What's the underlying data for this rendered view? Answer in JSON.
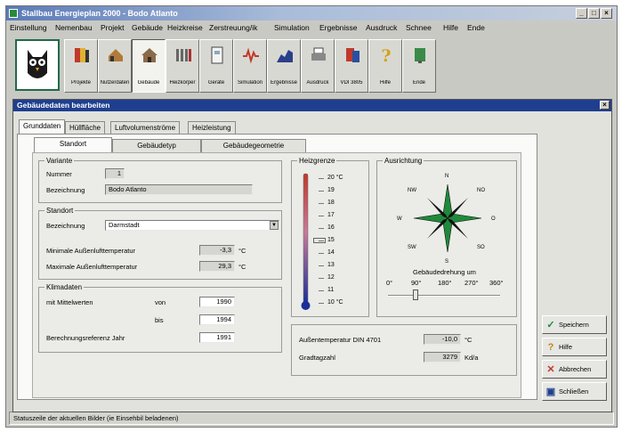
{
  "window": {
    "title": "Stallbau Energieplan 2000 - Bodo Atlanto",
    "controls": [
      "_",
      "□",
      "×"
    ]
  },
  "menu": [
    "Einstellung",
    "Nemenbau",
    "Projekt",
    "Gebäude",
    "Heizkreise",
    "Zerstreuung/ik",
    "Simulation",
    "Ergebnisse",
    "Ausdruck",
    "Schnee",
    "Hilfe",
    "Ende"
  ],
  "toolbar": [
    {
      "label": "Projekte",
      "icon": "project-icon"
    },
    {
      "label": "Nutzerdaten",
      "icon": "building-data-icon"
    },
    {
      "label": "Gebäude",
      "icon": "house-icon"
    },
    {
      "label": "Heizkörper",
      "icon": "radiator-icon"
    },
    {
      "label": "Geräte",
      "icon": "device-icon"
    },
    {
      "label": "Simulation",
      "icon": "simulation-icon"
    },
    {
      "label": "Ergebnisse",
      "icon": "results-chart-icon"
    },
    {
      "label": "Ausdruck",
      "icon": "printer-icon"
    },
    {
      "label": "VDI 3805",
      "icon": "vdi-icon"
    },
    {
      "label": "Hilfe",
      "icon": "help-icon"
    },
    {
      "label": "Ende",
      "icon": "exit-icon"
    }
  ],
  "dialog": {
    "title": "Gebäudedaten bearbeiten",
    "tabs": [
      "Grunddaten",
      "Hüllfläche",
      "Luftvolumenströme",
      "Heizleistung"
    ],
    "subtabs": [
      "Standort",
      "Gebäudetyp",
      "Gebäudegeometrie"
    ],
    "variante": {
      "group_title": "Variante",
      "nummer_label": "Nummer",
      "nummer_value": "1",
      "bezeichnung_label": "Bezeichnung",
      "bezeichnung_value": "Bodo Atlanto"
    },
    "standort": {
      "group_title": "Standort",
      "bezeichnung_label": "Bezeichnung",
      "bezeichnung_value": "Darmstadt",
      "min_temp_label": "Minimale Außenlufttemperatur",
      "min_temp_value": "-3,3",
      "max_temp_label": "Maximale Außenlufttemperatur",
      "max_temp_value": "29,3",
      "unit": "°C"
    },
    "klimadaten": {
      "group_title": "Klimadaten",
      "mittelwerte_label": "mit Mittelwerten",
      "von_label": "von",
      "von_value": "1990",
      "bis_label": "bis",
      "bis_value": "1994",
      "jahr_label": "Berechnungsreferenz Jahr",
      "jahr_value": "1991"
    },
    "heizgrenze": {
      "group_title": "Heizgrenze",
      "scale": [
        "20 °C",
        "19",
        "18",
        "17",
        "16",
        "15",
        "14",
        "13",
        "12",
        "11",
        "10 °C"
      ],
      "level": 0.5
    },
    "ausrichtung": {
      "group_title": "Ausrichtung",
      "compass": [
        "N",
        "NO",
        "O",
        "SO",
        "S",
        "SW",
        "W",
        "NW"
      ],
      "drehung_label": "Gebäudedrehung um",
      "degrees": [
        "0°",
        "90°",
        "180°",
        "270°",
        "360°"
      ]
    },
    "summary": {
      "temp_label": "Außentemperatur DIN 4701",
      "temp_value": "-10,0",
      "temp_unit": "°C",
      "kelvin_label": "Gradtagzahl",
      "kelvin_value": "3279",
      "kelvin_unit": "Kd/a"
    },
    "buttons": [
      "Speichern",
      "Hilfe",
      "Abbrechen",
      "Schließen"
    ]
  },
  "status": "Statuszeile der aktuellen Bilder (ie Einsehbil beladenen)",
  "colors": {
    "title_active": "#1f3f8e",
    "logo_border": "#1f6a4a",
    "thermo_hot": "#c0392b",
    "thermo_cold": "#1a2f9a",
    "compass_green": "#1f8a3a"
  }
}
